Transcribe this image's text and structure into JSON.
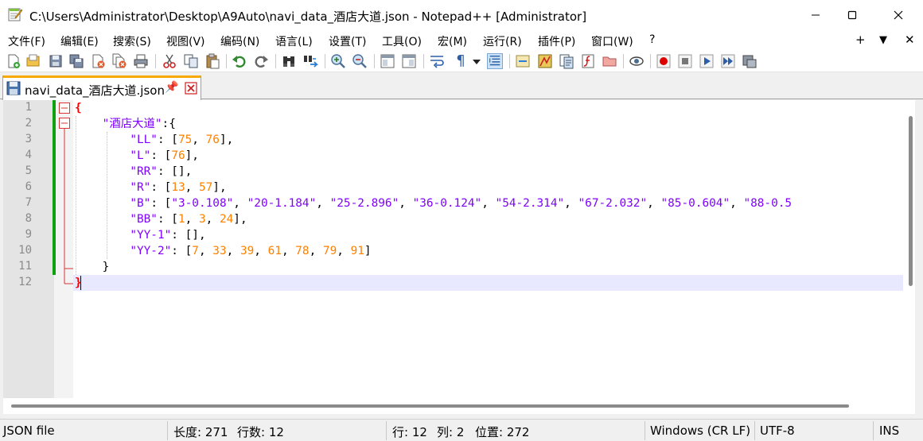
{
  "window": {
    "title": "C:\\Users\\Administrator\\Desktop\\A9Auto\\navi_data_酒店大道.json - Notepad++ [Administrator]",
    "minimize_icon": "minimize-icon",
    "maximize_icon": "maximize-icon",
    "close_icon": "close-icon"
  },
  "menu": {
    "items": [
      "文件(F)",
      "编辑(E)",
      "搜索(S)",
      "视图(V)",
      "编码(N)",
      "语言(L)",
      "设置(T)",
      "工具(O)",
      "宏(M)",
      "运行(R)",
      "插件(P)",
      "窗口(W)",
      "?"
    ],
    "right": [
      "+",
      "▼",
      "✕"
    ]
  },
  "toolbar": {
    "icons": [
      "new-file-icon",
      "open-file-icon",
      "save-icon",
      "save-all-icon",
      "close-icon",
      "close-all-icon",
      "print-icon",
      "cut-icon",
      "copy-icon",
      "paste-icon",
      "undo-icon",
      "redo-icon",
      "find-icon",
      "replace-icon",
      "zoom-in-icon",
      "zoom-out-icon",
      "sync-vertical-icon",
      "sync-horizontal-icon",
      "word-wrap-icon",
      "show-all-chars-icon",
      "dropdown-icon",
      "indent-guide-icon",
      "udl-icon",
      "doc-map-icon",
      "doc-list-icon",
      "function-list-icon",
      "folder-workspace-icon",
      "monitoring-icon",
      "record-macro-icon",
      "stop-macro-icon",
      "play-macro-icon",
      "run-macro-multiple-icon",
      "save-macro-icon"
    ]
  },
  "tab": {
    "label": "navi_data_酒店大道.json",
    "pin": "📌"
  },
  "editor": {
    "line_numbers": [
      "1",
      "2",
      "3",
      "4",
      "5",
      "6",
      "7",
      "8",
      "9",
      "10",
      "11",
      "12"
    ],
    "lines": [
      [
        {
          "t": "{",
          "c": "brace-red"
        }
      ],
      [
        {
          "t": "    ",
          "c": "op"
        },
        {
          "t": "\"酒店大道\"",
          "c": "key"
        },
        {
          "t": ":{",
          "c": "op"
        }
      ],
      [
        {
          "t": "        ",
          "c": "op"
        },
        {
          "t": "\"LL\"",
          "c": "key"
        },
        {
          "t": ": [",
          "c": "op"
        },
        {
          "t": "75",
          "c": "num"
        },
        {
          "t": ", ",
          "c": "op"
        },
        {
          "t": "76",
          "c": "num"
        },
        {
          "t": "],",
          "c": "op"
        }
      ],
      [
        {
          "t": "        ",
          "c": "op"
        },
        {
          "t": "\"L\"",
          "c": "key"
        },
        {
          "t": ": [",
          "c": "op"
        },
        {
          "t": "76",
          "c": "num"
        },
        {
          "t": "],",
          "c": "op"
        }
      ],
      [
        {
          "t": "        ",
          "c": "op"
        },
        {
          "t": "\"RR\"",
          "c": "key"
        },
        {
          "t": ": [],",
          "c": "op"
        }
      ],
      [
        {
          "t": "        ",
          "c": "op"
        },
        {
          "t": "\"R\"",
          "c": "key"
        },
        {
          "t": ": [",
          "c": "op"
        },
        {
          "t": "13",
          "c": "num"
        },
        {
          "t": ", ",
          "c": "op"
        },
        {
          "t": "57",
          "c": "num"
        },
        {
          "t": "],",
          "c": "op"
        }
      ],
      [
        {
          "t": "        ",
          "c": "op"
        },
        {
          "t": "\"B\"",
          "c": "key"
        },
        {
          "t": ": [",
          "c": "op"
        },
        {
          "t": "\"3-0.108\"",
          "c": "str"
        },
        {
          "t": ", ",
          "c": "op"
        },
        {
          "t": "\"20-1.184\"",
          "c": "str"
        },
        {
          "t": ", ",
          "c": "op"
        },
        {
          "t": "\"25-2.896\"",
          "c": "str"
        },
        {
          "t": ", ",
          "c": "op"
        },
        {
          "t": "\"36-0.124\"",
          "c": "str"
        },
        {
          "t": ", ",
          "c": "op"
        },
        {
          "t": "\"54-2.314\"",
          "c": "str"
        },
        {
          "t": ", ",
          "c": "op"
        },
        {
          "t": "\"67-2.032\"",
          "c": "str"
        },
        {
          "t": ", ",
          "c": "op"
        },
        {
          "t": "\"85-0.604\"",
          "c": "str"
        },
        {
          "t": ", ",
          "c": "op"
        },
        {
          "t": "\"88-0.5",
          "c": "str"
        }
      ],
      [
        {
          "t": "        ",
          "c": "op"
        },
        {
          "t": "\"BB\"",
          "c": "key"
        },
        {
          "t": ": [",
          "c": "op"
        },
        {
          "t": "1",
          "c": "num"
        },
        {
          "t": ", ",
          "c": "op"
        },
        {
          "t": "3",
          "c": "num"
        },
        {
          "t": ", ",
          "c": "op"
        },
        {
          "t": "24",
          "c": "num"
        },
        {
          "t": "],",
          "c": "op"
        }
      ],
      [
        {
          "t": "        ",
          "c": "op"
        },
        {
          "t": "\"YY-1\"",
          "c": "key"
        },
        {
          "t": ": [],",
          "c": "op"
        }
      ],
      [
        {
          "t": "        ",
          "c": "op"
        },
        {
          "t": "\"YY-2\"",
          "c": "key"
        },
        {
          "t": ": [",
          "c": "op"
        },
        {
          "t": "7",
          "c": "num"
        },
        {
          "t": ", ",
          "c": "op"
        },
        {
          "t": "33",
          "c": "num"
        },
        {
          "t": ", ",
          "c": "op"
        },
        {
          "t": "39",
          "c": "num"
        },
        {
          "t": ", ",
          "c": "op"
        },
        {
          "t": "61",
          "c": "num"
        },
        {
          "t": ", ",
          "c": "op"
        },
        {
          "t": "78",
          "c": "num"
        },
        {
          "t": ", ",
          "c": "op"
        },
        {
          "t": "79",
          "c": "num"
        },
        {
          "t": ", ",
          "c": "op"
        },
        {
          "t": "91",
          "c": "num"
        },
        {
          "t": "]",
          "c": "op"
        }
      ],
      [
        {
          "t": "    }",
          "c": "op"
        }
      ],
      [
        {
          "t": "}",
          "c": "brace-red"
        }
      ]
    ],
    "current_line": 12
  },
  "status": {
    "file_type": "JSON file",
    "length": "长度: 271",
    "lines": "行数: 12",
    "row": "行: 12",
    "col": "列: 2",
    "pos": "位置: 272",
    "eol": "Windows (CR LF)",
    "encoding": "UTF-8",
    "mode": "INS"
  },
  "colors": {
    "keyword": "#8000ff",
    "number": "#ff8000",
    "brace": "#ff0000",
    "change_bar": "#10a010",
    "current_line": "#e8e8ff",
    "tab_accent": "#f7a900"
  }
}
